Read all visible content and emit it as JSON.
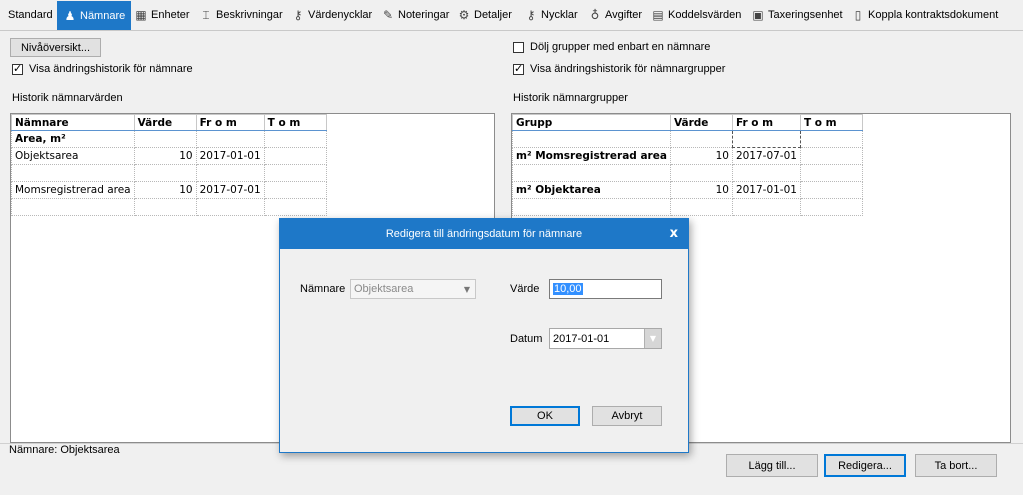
{
  "tabs": [
    {
      "label": "Standard",
      "icon": ""
    },
    {
      "label": "Nämnare",
      "icon": "person-icon"
    },
    {
      "label": "Enheter",
      "icon": "grid-icon"
    },
    {
      "label": "Beskrivningar",
      "icon": "text-cursor-icon"
    },
    {
      "label": "Värdenycklar",
      "icon": "key-icon"
    },
    {
      "label": "Noteringar",
      "icon": "notes-icon"
    },
    {
      "label": "Detaljer",
      "icon": "gears-icon"
    },
    {
      "label": "Nycklar",
      "icon": "key-icon"
    },
    {
      "label": "Avgifter",
      "icon": "money-bag-icon"
    },
    {
      "label": "Koddelsvärden",
      "icon": "table-icon"
    },
    {
      "label": "Taxeringsenhet",
      "icon": "box-icon"
    },
    {
      "label": "Koppla kontraktsdokument",
      "icon": "document-icon"
    }
  ],
  "controls": {
    "level_overview_button": "Nivåöversikt...",
    "show_history_denominator": "Visa ändringshistorik för nämnare",
    "hide_single_groups": "Dölj grupper med enbart en nämnare",
    "show_history_groups": "Visa ändringshistorik för nämnargrupper"
  },
  "left_grid": {
    "title": "Historik nämnarvärden",
    "columns": [
      "Nämnare",
      "Värde",
      "Fr o m",
      "T o m"
    ],
    "rows": [
      {
        "name": "Area, m²",
        "value": "",
        "from": "",
        "to": "",
        "bold": true
      },
      {
        "name": "Objektsarea",
        "value": "10",
        "from": "2017-01-01",
        "to": ""
      },
      {
        "name": "",
        "value": "",
        "from": "",
        "to": ""
      },
      {
        "name": "Momsregistrerad area",
        "value": "10",
        "from": "2017-07-01",
        "to": ""
      },
      {
        "name": "",
        "value": "",
        "from": "",
        "to": ""
      }
    ]
  },
  "right_grid": {
    "title": "Historik nämnargrupper",
    "columns": [
      "Grupp",
      "Värde",
      "Fr o m",
      "T o m"
    ],
    "rows": [
      {
        "name": "",
        "value": "",
        "from": "",
        "to": ""
      },
      {
        "name": "m² Momsregistrerad area",
        "value": "10",
        "from": "2017-07-01",
        "to": "",
        "bold": true
      },
      {
        "name": "",
        "value": "",
        "from": "",
        "to": ""
      },
      {
        "name": "m² Objektarea",
        "value": "10",
        "from": "2017-01-01",
        "to": "",
        "bold": true
      },
      {
        "name": "",
        "value": "",
        "from": "",
        "to": ""
      }
    ]
  },
  "status": {
    "text": "Nämnare: Objektsarea"
  },
  "bottom_buttons": {
    "add": "Lägg till...",
    "edit": "Redigera...",
    "delete": "Ta bort..."
  },
  "dialog": {
    "title": "Redigera till ändringsdatum för nämnare",
    "close": "x",
    "denominator_label": "Nämnare",
    "denominator_value": "Objektsarea",
    "value_label": "Värde",
    "value": "10,00",
    "date_label": "Datum",
    "date": "2017-01-01",
    "ok": "OK",
    "cancel": "Avbryt"
  },
  "colors": {
    "accent": "#1e78c8"
  }
}
